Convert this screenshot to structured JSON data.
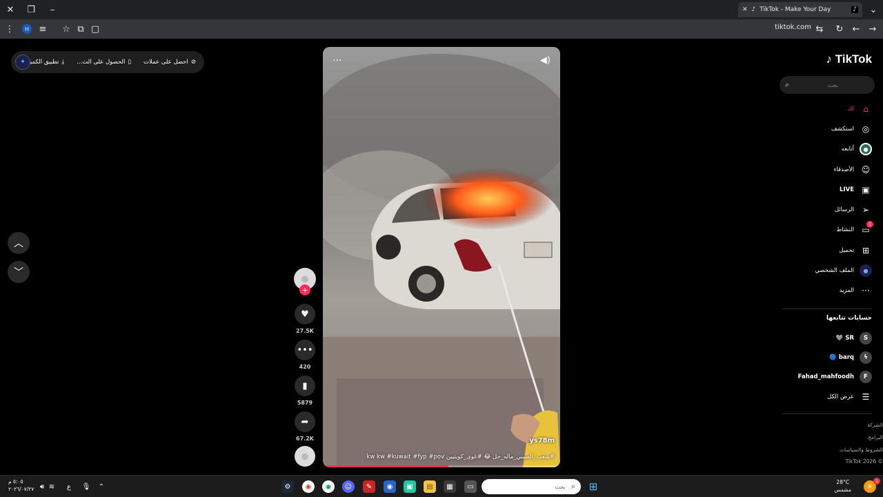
{
  "browser": {
    "tab_title": "TikTok - Make Your Day",
    "url": "tiktok.com",
    "profile_letter": "H"
  },
  "top_pill": {
    "item1": "احصل على عملات",
    "item2": "الحصول على الت...",
    "item3": "تطبيق الكمبيوتر"
  },
  "video": {
    "username": "ys78m",
    "caption": "#شعب_الصيني_ماله_حل 😂 #غوى_كويتيين kw kw #kuwait #fyp #pov",
    "progress": 0.53
  },
  "actions": {
    "likes": "27.5K",
    "comments": "420",
    "bookmarks": "5879",
    "shares": "67.2K"
  },
  "sidebar": {
    "logo": "TikTok",
    "search_placeholder": "بحث",
    "items": [
      {
        "label": "لك",
        "icon": "home-icon",
        "glyph": "⌂"
      },
      {
        "label": "استكشف",
        "icon": "compass-icon",
        "glyph": "◎"
      },
      {
        "label": "أتابعه",
        "icon": "following-avatar-icon",
        "glyph": "●"
      },
      {
        "label": "الأصدقاء",
        "icon": "friends-icon",
        "glyph": "☺"
      },
      {
        "label": "LIVE",
        "icon": "live-icon",
        "glyph": "▣"
      },
      {
        "label": "الرسائل",
        "icon": "messages-icon",
        "glyph": "➢"
      },
      {
        "label": "النشاط",
        "icon": "activity-icon",
        "glyph": "▭"
      },
      {
        "label": "تحميل",
        "icon": "upload-icon",
        "glyph": "⊞"
      },
      {
        "label": "الملف الشخصي",
        "icon": "profile-avatar-icon",
        "glyph": "●"
      },
      {
        "label": "المزيد",
        "icon": "more-icon",
        "glyph": "···"
      }
    ],
    "activity_badge": "1",
    "following_title": "حسابات تتابعها",
    "following": [
      {
        "name": "SR 🩶",
        "avatar": "S"
      },
      {
        "name": "barq 🔵",
        "avatar": "ϟ"
      },
      {
        "name": "Fahad_mahfoodh",
        "avatar": "F"
      }
    ],
    "see_all": "عرض الكل",
    "footer": [
      "الشركة",
      "البرامج",
      "الشروط والسياسات",
      "© 2026 TikTok"
    ]
  },
  "taskbar": {
    "search_placeholder": "بحث",
    "time": "٥:٠٥ م",
    "date": "٢٠٢٦/٠٧/٢٧",
    "temp": "28°C",
    "weather": "مشمس",
    "lang": "ع",
    "notif_count": "1"
  },
  "colors": {
    "accent": "#fe2c55",
    "background": "#000000",
    "surface": "#1f1f1f"
  }
}
